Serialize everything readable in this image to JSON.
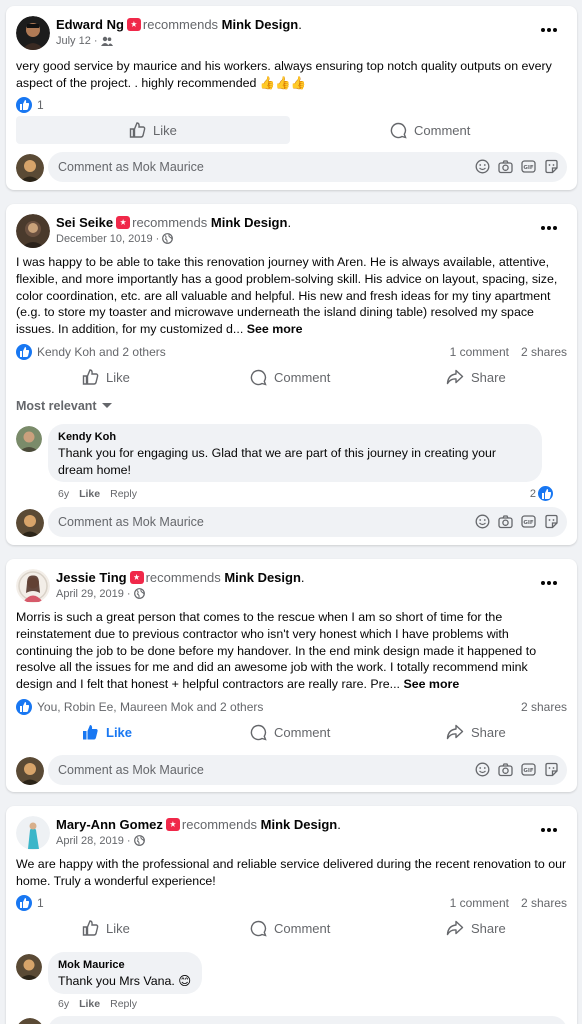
{
  "posts": [
    {
      "author": "Edward Ng",
      "recommends": "recommends",
      "page": "Mink Design",
      "page_suffix": ".",
      "date": "July 12",
      "audience_icon": "friends-icon",
      "text": "very good service by maurice and his workers. always ensuring top notch quality outputs on every aspect of the project. . highly recommended 👍👍👍",
      "see_more": "",
      "likes_summary": "1",
      "comment_count": "",
      "share_count": "",
      "liked": false
    },
    {
      "author": "Sei Seike",
      "recommends": "recommends",
      "page": "Mink Design",
      "page_suffix": ".",
      "date": "December 10, 2019 ·",
      "audience_icon": "globe-icon",
      "text": "I was happy to be able to take this renovation journey with Aren. He is always available, attentive, flexible, and more importantly has a good problem-solving skill. His advice on layout, spacing, size, color coordination, etc. are all valuable and helpful. His new and fresh ideas for my tiny apartment (e.g. to store my toaster and microwave underneath the island dining table) resolved my space issues. In addition, for my customized d...",
      "see_more": "See more",
      "likes_summary": "Kendy Koh and 2 others",
      "comment_count": "1 comment",
      "share_count": "2 shares",
      "liked": false,
      "sort_label": "Most relevant",
      "reply": {
        "author": "Kendy Koh",
        "text": "Thank you for engaging us. Glad that we are part of this journey in creating your dream home!",
        "age": "6y",
        "like": "Like",
        "reply": "Reply",
        "reactions": "2"
      }
    },
    {
      "author": "Jessie Ting",
      "recommends": "recommends",
      "page": "Mink Design",
      "page_suffix": ".",
      "date": "April 29, 2019 ·",
      "audience_icon": "globe-icon",
      "text": "Morris is such a great person that comes to the rescue when I am so short of time for the reinstatement due to previous contractor who isn't very honest which I have problems with continuing the job to be done before my handover. In the end mink design made it happened to resolve all the issues for me and did an awesome job with the work. I totally recommend mink design and I felt that honest + helpful contractors are really rare. Pre...",
      "see_more": "See more",
      "likes_summary": "You, Robin Ee, Maureen Mok and 2 others",
      "comment_count": "",
      "share_count": "2 shares",
      "liked": true
    },
    {
      "author": "Mary-Ann Gomez",
      "recommends": "recommends",
      "page": "Mink Design",
      "page_suffix": ".",
      "date": "April 28, 2019 ·",
      "audience_icon": "globe-icon",
      "text": "We are happy with the professional and reliable service delivered during the recent renovation to our home. Truly a wonderful experience!",
      "see_more": "",
      "likes_summary": "1",
      "comment_count": "1 comment",
      "share_count": "2 shares",
      "liked": false,
      "reply": {
        "author": "Mok Maurice",
        "text": "Thank you Mrs Vana. 😊",
        "age": "6y",
        "like": "Like",
        "reply": "Reply",
        "reactions": ""
      }
    }
  ],
  "actions": {
    "like": "Like",
    "comment": "Comment",
    "share": "Share"
  },
  "comment_placeholder": "Comment as Mok Maurice",
  "composer_icons": [
    "emoji-icon",
    "camera-icon",
    "gif-icon",
    "sticker-icon"
  ],
  "colors": {
    "accent": "#1877f2",
    "badge": "#f02849",
    "muted": "#65676b",
    "bg": "#f0f2f5"
  }
}
